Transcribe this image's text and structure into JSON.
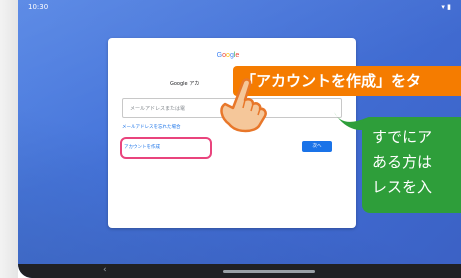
{
  "status_bar": {
    "time": "10:30",
    "icons": "▾ ▮"
  },
  "signin_card": {
    "logo": [
      "G",
      "o",
      "o",
      "g",
      "l",
      "e"
    ],
    "heading": "Google アカ",
    "email_placeholder": "メールアドレスまたは電",
    "forgot_link": "メールアドレスを忘れた場合",
    "create_account": "アカウントを作成",
    "next_button": "次へ"
  },
  "callouts": {
    "orange": "「アカウントを作成」をタ",
    "green_lines": [
      "すでにア",
      "ある方は",
      "レスを入"
    ]
  },
  "nav_bar": {
    "back": "‹"
  },
  "colors": {
    "callout_orange": "#f57c00",
    "callout_green": "#2e9e3a",
    "highlight": "#e9447d",
    "google_blue": "#1a73e8"
  }
}
